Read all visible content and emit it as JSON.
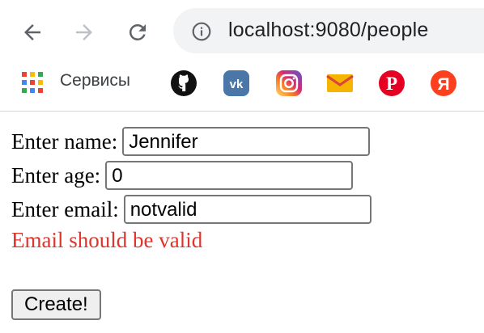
{
  "browser": {
    "url": "localhost:9080/people",
    "bookmarks": {
      "apps_label": "Сервисы",
      "items": [
        "github",
        "vk",
        "instagram",
        "gmail",
        "pinterest",
        "yandex"
      ]
    }
  },
  "form": {
    "name_label": "Enter name:",
    "name_value": "Jennifer",
    "age_label": "Enter age:",
    "age_value": "0",
    "email_label": "Enter email:",
    "email_value": "notvalid",
    "email_error": "Email should be valid",
    "submit_label": "Create!"
  },
  "colors": {
    "error": "#e0332a",
    "omnibox_bg": "#f1f3f4"
  }
}
